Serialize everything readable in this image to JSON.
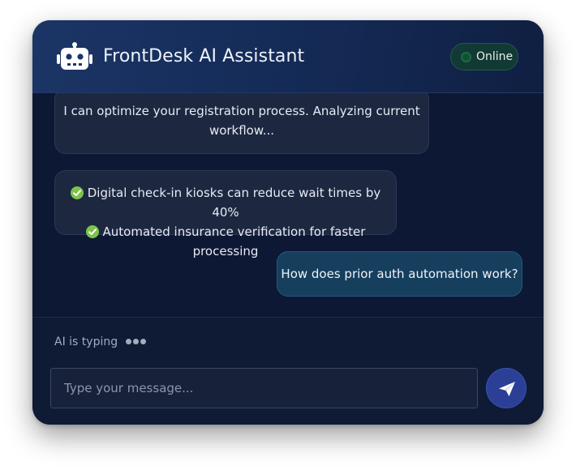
{
  "header": {
    "title": "FrontDesk AI Assistant",
    "bot_icon": "robot-icon",
    "status_label": "Online"
  },
  "messages": [
    {
      "sender": "ai",
      "lines": [
        "I can optimize your registration process. Analyzing current",
        "workflow..."
      ]
    },
    {
      "sender": "ai",
      "items": [
        {
          "icon": "check-icon",
          "text": "Digital check-in kiosks can reduce wait times by 40%"
        },
        {
          "icon": "check-icon",
          "text": "Automated insurance verification for faster processing"
        }
      ]
    },
    {
      "sender": "user",
      "text": "How does prior auth automation work?"
    }
  ],
  "footer": {
    "typing_label": "AI is typing",
    "input_value": "",
    "input_placeholder": "Type your message...",
    "send_icon": "send-icon"
  },
  "colors": {
    "card_bg": "#0d1834",
    "header_accent": "#1b3566",
    "online_bg": "#123a34",
    "user_bubble": "#163f5e",
    "ai_bubble": "#1d2740",
    "send_button": "#2b3f96",
    "check": "#7bc44a"
  }
}
